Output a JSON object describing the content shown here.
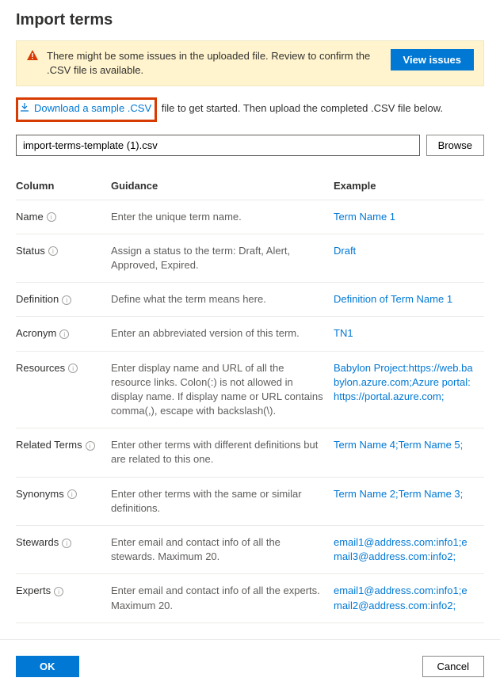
{
  "title": "Import terms",
  "warning": {
    "text": "There might be some issues in the uploaded file. Review to confirm the .CSV file is available.",
    "button": "View issues"
  },
  "download": {
    "link_text": "Download a sample .CSV",
    "suffix_text": " file to get started. Then upload the completed .CSV file below."
  },
  "file": {
    "value": "import-terms-template (1).csv",
    "browse": "Browse"
  },
  "table": {
    "headers": {
      "column": "Column",
      "guidance": "Guidance",
      "example": "Example"
    },
    "rows": [
      {
        "name": "Name",
        "info": true,
        "guidance": "Enter the unique term name.",
        "example": "Term Name 1"
      },
      {
        "name": "Status",
        "info": true,
        "guidance": "Assign a status to the term: Draft, Alert, Approved, Expired.",
        "example": "Draft"
      },
      {
        "name": "Definition",
        "info": true,
        "guidance": "Define what the term means here.",
        "example": "Definition of Term Name 1"
      },
      {
        "name": "Acronym",
        "info": true,
        "guidance": "Enter an abbreviated version of this term.",
        "example": "TN1"
      },
      {
        "name": "Resources",
        "info": true,
        "guidance": "Enter display name and URL of all the resource links. Colon(:) is not allowed in display name. If display name or URL contains comma(,), escape with backslash(\\).",
        "example": "Babylon Project:https://web.babylon.azure.com;Azure portal:https://portal.azure.com;"
      },
      {
        "name": "Related Terms",
        "info": true,
        "guidance": "Enter other terms with different definitions but are related to this one.",
        "example": "Term Name 4;Term Name 5;"
      },
      {
        "name": "Synonyms",
        "info": true,
        "guidance": "Enter other terms with the same or similar definitions.",
        "example": "Term Name 2;Term Name 3;"
      },
      {
        "name": "Stewards",
        "info": true,
        "guidance": "Enter email and contact info of all the stewards. Maximum 20.",
        "example": "email1@address.com:info1;email3@address.com:info2;"
      },
      {
        "name": "Experts",
        "info": true,
        "guidance": "Enter email and contact info of all the experts. Maximum 20.",
        "example": "email1@address.com:info1;email2@address.com:info2;"
      }
    ]
  },
  "footer": {
    "ok": "OK",
    "cancel": "Cancel"
  }
}
